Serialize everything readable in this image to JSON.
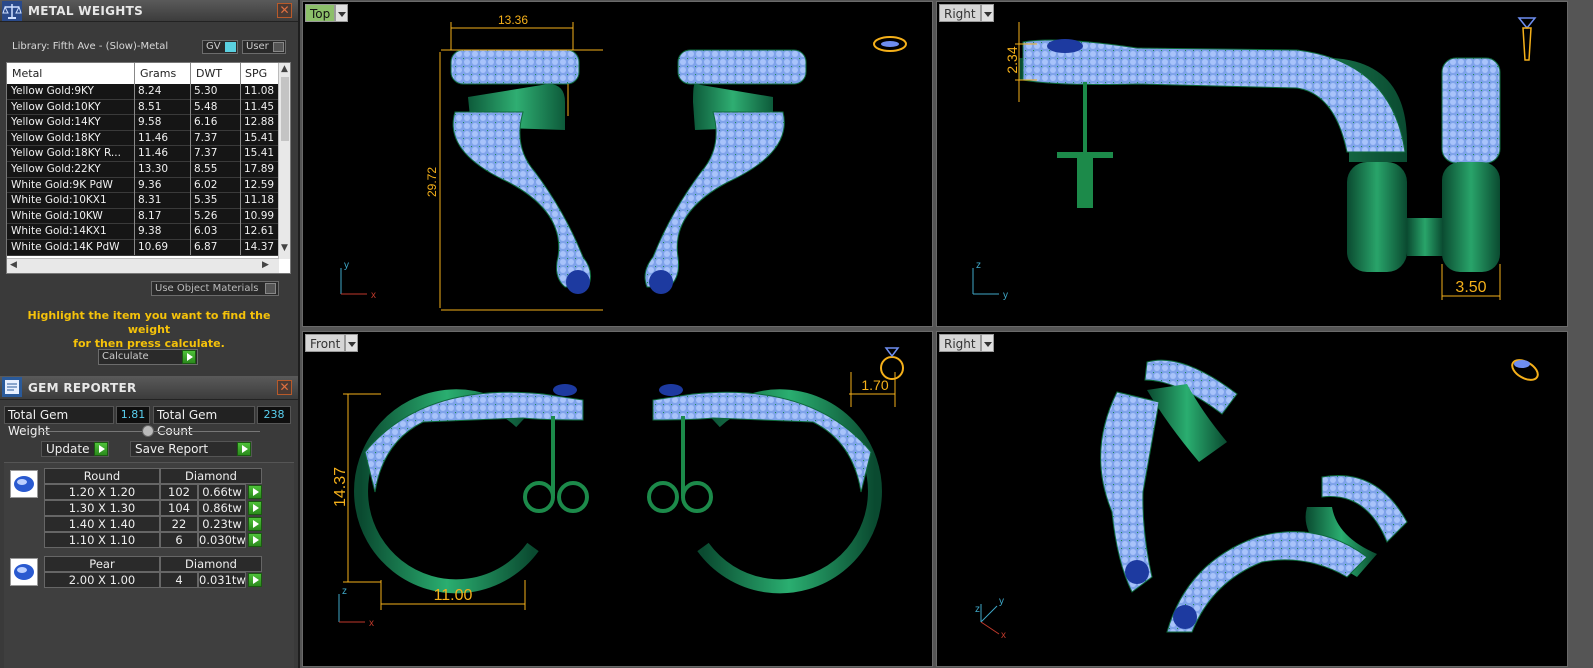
{
  "metal_weights": {
    "title": "METAL WEIGHTS",
    "library": "Library: Fifth Ave - (Slow)-Metal",
    "gv_label": "GV",
    "user_label": "User",
    "columns": [
      "Metal",
      "Grams",
      "DWT",
      "SPG"
    ],
    "rows": [
      [
        "Yellow Gold:9KY",
        "8.24",
        "5.30",
        "11.08"
      ],
      [
        "Yellow Gold:10KY",
        "8.51",
        "5.48",
        "11.45"
      ],
      [
        "Yellow Gold:14KY",
        "9.58",
        "6.16",
        "12.88"
      ],
      [
        "Yellow Gold:18KY",
        "11.46",
        "7.37",
        "15.41"
      ],
      [
        "Yellow Gold:18KY R...",
        "11.46",
        "7.37",
        "15.41"
      ],
      [
        "Yellow Gold:22KY",
        "13.30",
        "8.55",
        "17.89"
      ],
      [
        "White Gold:9K PdW",
        "9.36",
        "6.02",
        "12.59"
      ],
      [
        "White Gold:10KX1",
        "8.31",
        "5.35",
        "11.18"
      ],
      [
        "White Gold:10KW",
        "8.17",
        "5.26",
        "10.99"
      ],
      [
        "White Gold:14KX1",
        "9.38",
        "6.03",
        "12.61"
      ],
      [
        "White Gold:14K PdW",
        "10.69",
        "6.87",
        "14.37"
      ]
    ],
    "use_object_materials": "Use Object Materials",
    "hint_line1": "Highlight the item you want to find the weight",
    "hint_line2": "for then press calculate.",
    "calculate_label": "Calculate"
  },
  "gem_reporter": {
    "title": "GEM REPORTER",
    "total_weight_label": "Total Gem Weight",
    "total_weight_value": "1.81",
    "total_count_label": "Total Gem Count",
    "total_count_value": "238",
    "update_label": "Update",
    "save_report_label": "Save Report",
    "groups": [
      {
        "shape": "Round",
        "material": "Diamond",
        "rows": [
          [
            "1.20 X 1.20",
            "102",
            "0.66tw"
          ],
          [
            "1.30 X 1.30",
            "104",
            "0.86tw"
          ],
          [
            "1.40 X 1.40",
            "22",
            "0.23tw"
          ],
          [
            "1.10 X 1.10",
            "6",
            "0.030tw"
          ]
        ]
      },
      {
        "shape": "Pear",
        "material": "Diamond",
        "rows": [
          [
            "2.00 X 1.00",
            "4",
            "0.031tw"
          ]
        ]
      }
    ]
  },
  "viewports": {
    "top": {
      "label": "Top",
      "dim_width": "13.36",
      "dim_height": "29.72",
      "axis1": "y",
      "axis2": "x"
    },
    "right1": {
      "label": "Right",
      "dim_a": "2.34",
      "dim_b": "3.50",
      "axis1": "z",
      "axis2": "y"
    },
    "front": {
      "label": "Front",
      "dim_height": "14.37",
      "dim_width": "11.00",
      "dim_small": "1.70",
      "axis1": "z",
      "axis2": "x"
    },
    "right2": {
      "label": "Right",
      "axis1": "z",
      "axis2": "y",
      "axis3": "x"
    }
  },
  "colors": {
    "metal": "#1f8f5a",
    "gem": "#8fb0f5",
    "dimension": "#f5b01a"
  }
}
